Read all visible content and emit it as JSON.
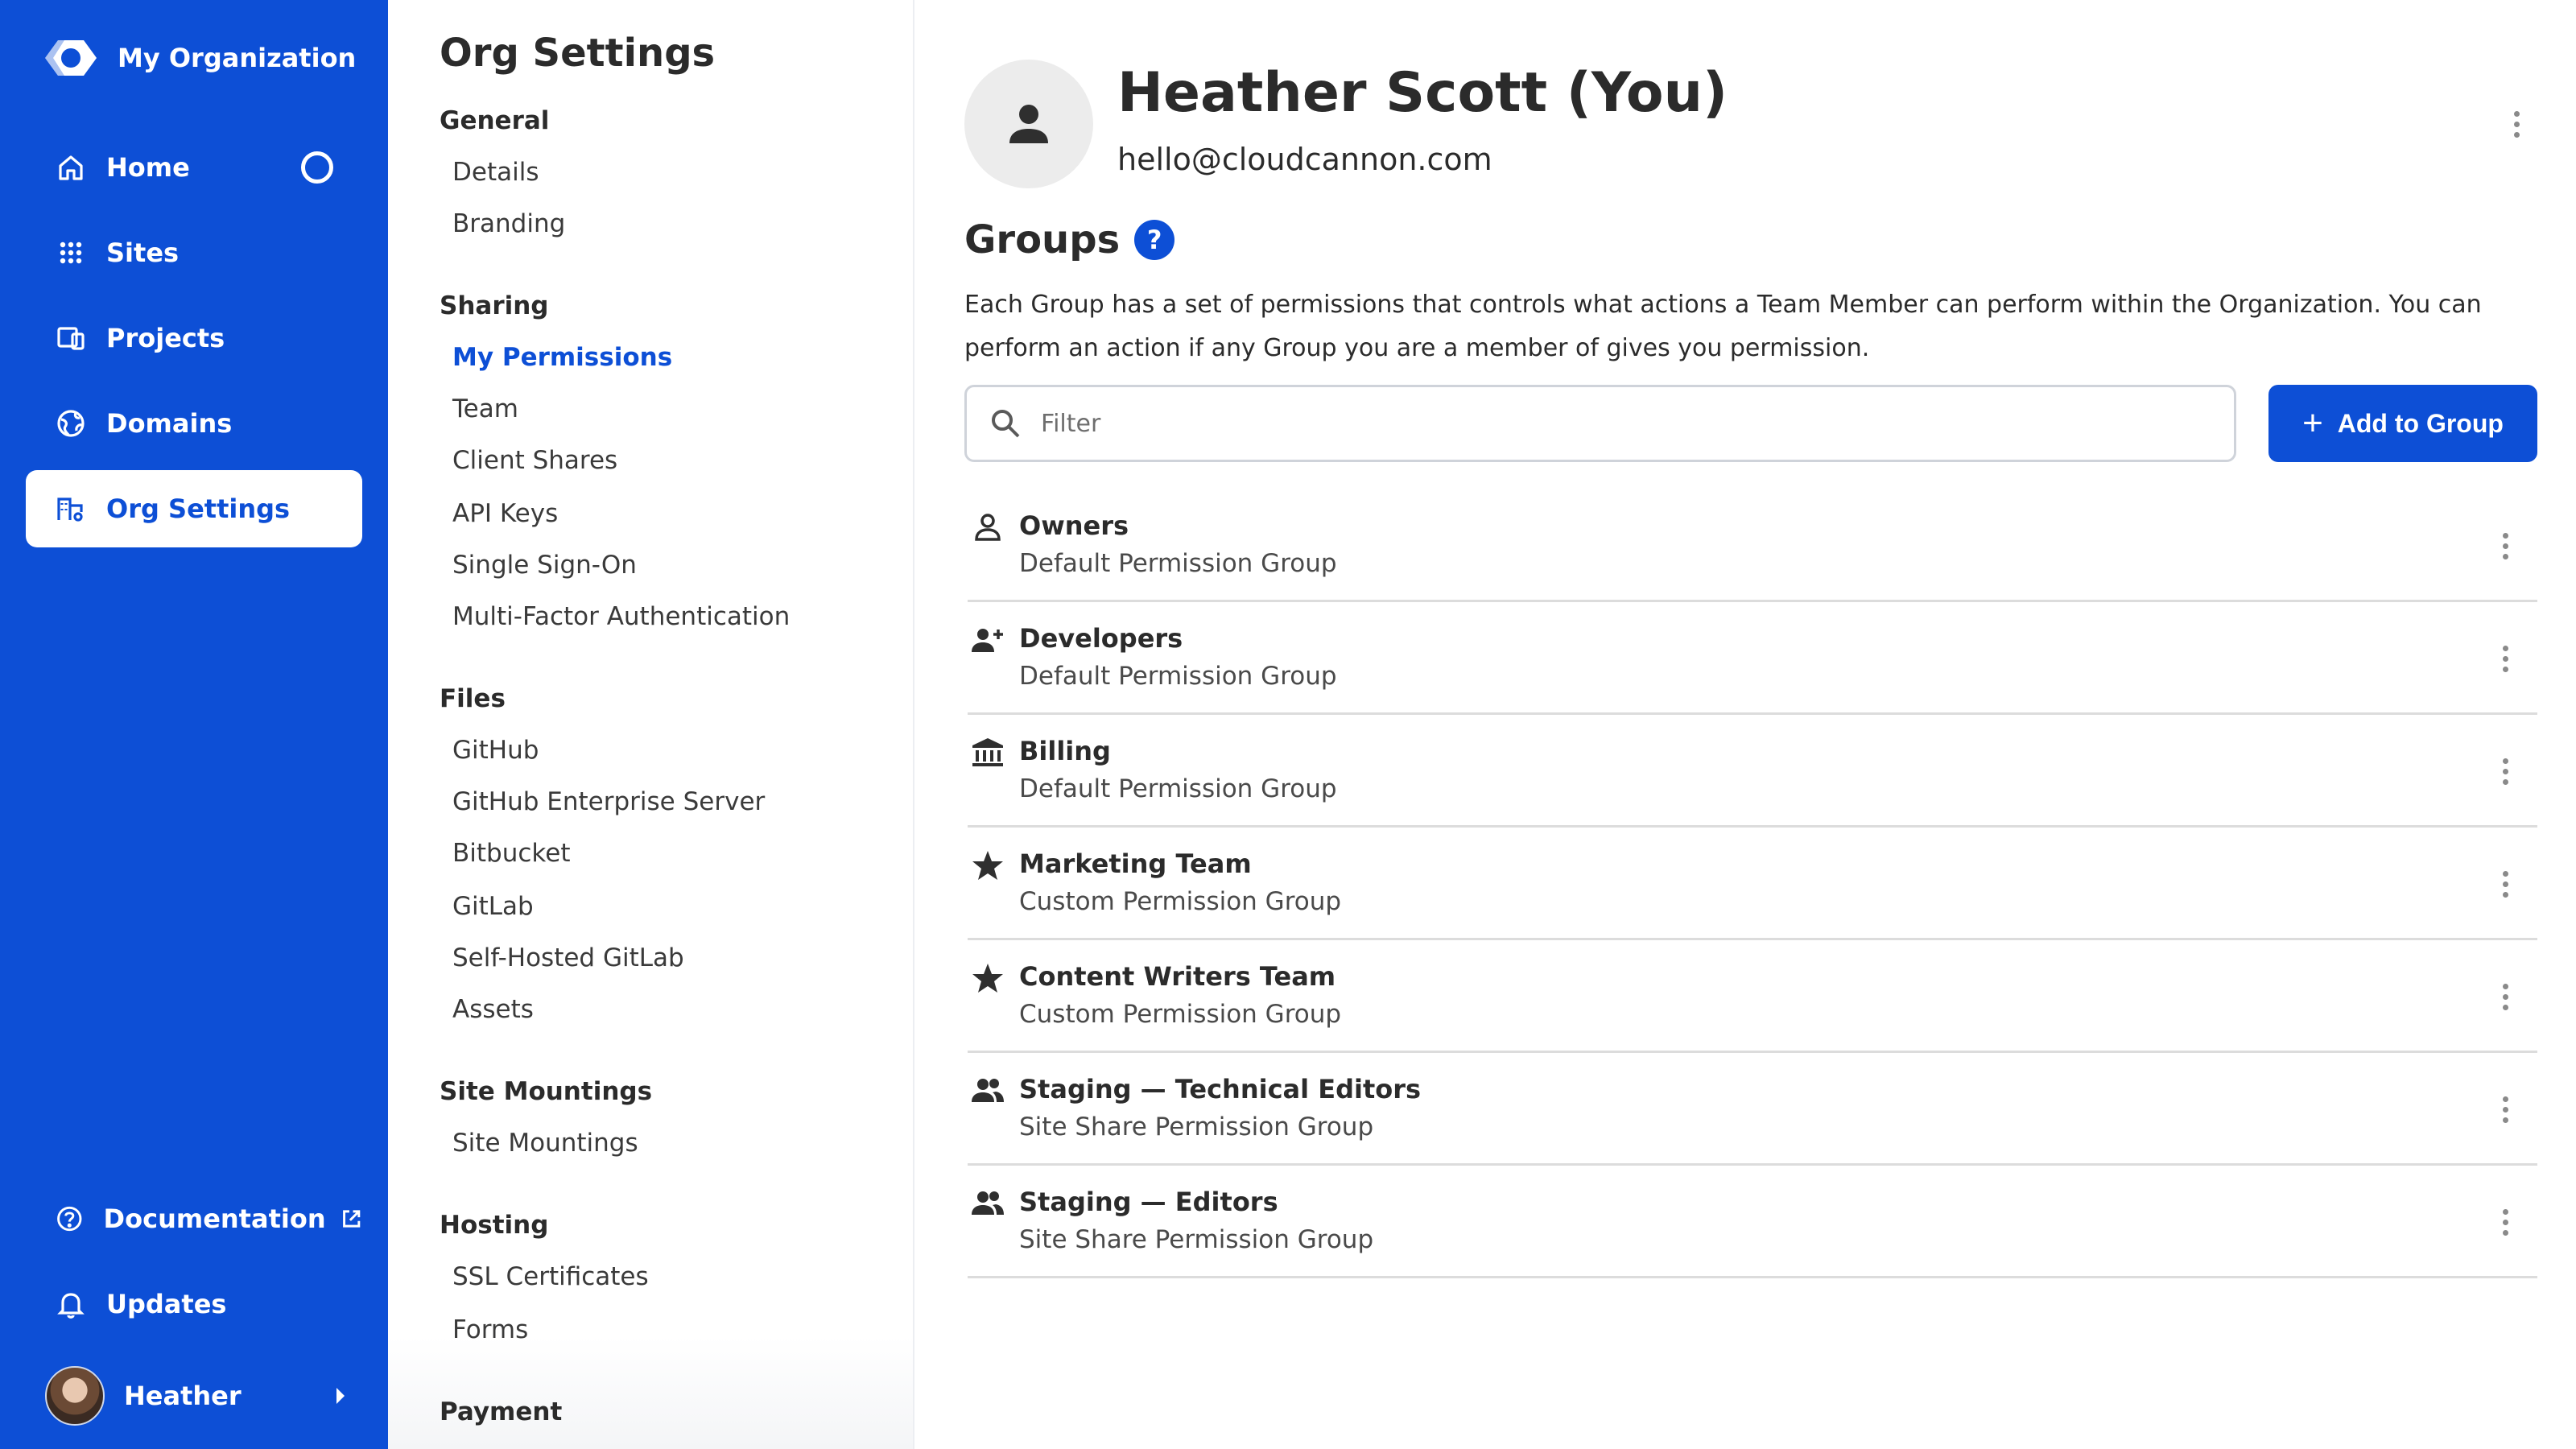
{
  "sidebar": {
    "org_name": "My Organization",
    "nav": [
      {
        "label": "Home",
        "icon": "home-icon"
      },
      {
        "label": "Sites",
        "icon": "grid-icon"
      },
      {
        "label": "Projects",
        "icon": "projects-icon"
      },
      {
        "label": "Domains",
        "icon": "globe-icon"
      },
      {
        "label": "Org Settings",
        "icon": "org-settings-icon",
        "active": true
      }
    ],
    "bottom_nav": [
      {
        "label": "Documentation",
        "icon": "help-circle-icon"
      },
      {
        "label": "Updates",
        "icon": "bell-icon"
      }
    ],
    "user": {
      "name": "Heather"
    }
  },
  "subnav": {
    "title": "Org Settings",
    "sections": [
      {
        "heading": "General",
        "links": [
          "Details",
          "Branding"
        ]
      },
      {
        "heading": "Sharing",
        "links": [
          "My Permissions",
          "Team",
          "Client Shares",
          "API Keys",
          "Single Sign-On",
          "Multi-Factor Authentication"
        ]
      },
      {
        "heading": "Files",
        "links": [
          "GitHub",
          "GitHub Enterprise Server",
          "Bitbucket",
          "GitLab",
          "Self-Hosted GitLab",
          "Assets"
        ]
      },
      {
        "heading": "Site Mountings",
        "links": [
          "Site Mountings"
        ]
      },
      {
        "heading": "Hosting",
        "links": [
          "SSL Certificates",
          "Forms"
        ]
      },
      {
        "heading": "Payment",
        "links": []
      }
    ],
    "active_link": "My Permissions"
  },
  "profile": {
    "name": "Heather Scott (You)",
    "email": "hello@cloudcannon.com"
  },
  "groups": {
    "title": "Groups",
    "help_symbol": "?",
    "description": "Each Group has a set of permissions that controls what actions a Team Member can perform within the Organization. You can perform an action if any Group you are a member of gives you permission.",
    "filter_placeholder": "Filter",
    "add_button_label": "Add to Group",
    "items": [
      {
        "name": "Owners",
        "type": "Default Permission Group",
        "icon": "person-outline-icon"
      },
      {
        "name": "Developers",
        "type": "Default Permission Group",
        "icon": "person-add-icon"
      },
      {
        "name": "Billing",
        "type": "Default Permission Group",
        "icon": "bank-icon"
      },
      {
        "name": "Marketing Team",
        "type": "Custom Permission Group",
        "icon": "star-icon"
      },
      {
        "name": "Content Writers Team",
        "type": "Custom Permission Group",
        "icon": "star-icon"
      },
      {
        "name": "Staging — Technical Editors",
        "type": "Site Share Permission Group",
        "icon": "people-icon"
      },
      {
        "name": "Staging — Editors",
        "type": "Site Share Permission Group",
        "icon": "people-icon"
      }
    ]
  },
  "colors": {
    "brand": "#0d4fd6",
    "divider": "#dcdcdc"
  }
}
